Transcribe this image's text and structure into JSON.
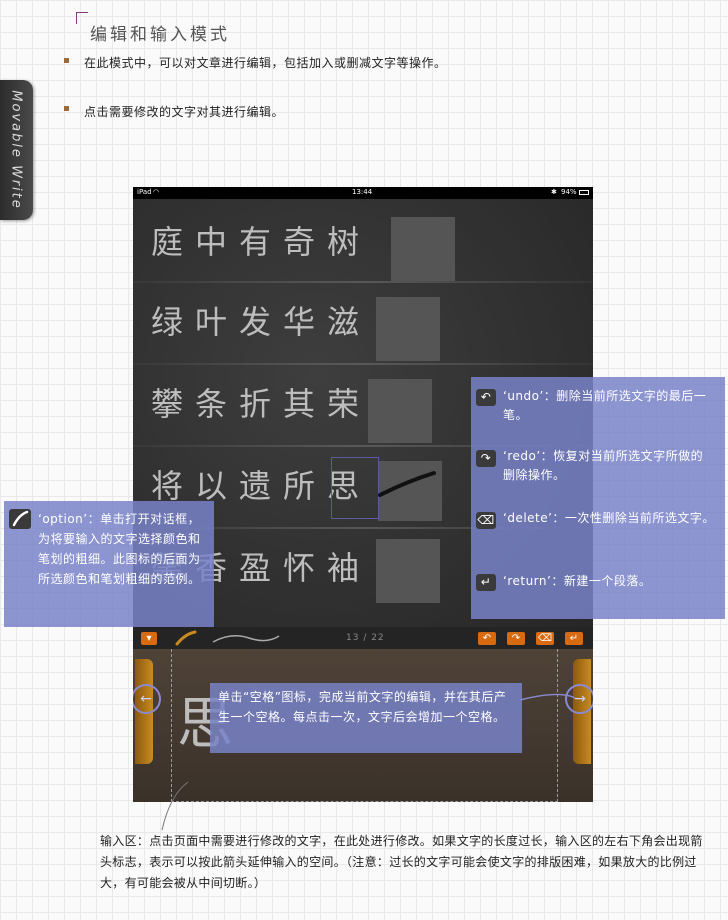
{
  "header": {
    "title": "编辑和输入模式",
    "bullets": [
      "在此模式中，可以对文章进行编辑，包括加入或删减文字等操作。",
      "点击需要修改的文字对其进行编辑。"
    ]
  },
  "side_tab": {
    "label": "Movable Write"
  },
  "ipad": {
    "status": {
      "carrier": "iPad",
      "time": "13:44",
      "battery": "94%"
    },
    "lines": [
      "庭中有奇树",
      "绿叶发华滋",
      "攀条折其荣",
      "将以遗所思",
      "馨香盈怀袖"
    ],
    "page_indicator": "13 / 22",
    "input_char": "思",
    "toolbar_icons": [
      "undo-icon",
      "redo-icon",
      "delete-icon",
      "return-icon"
    ]
  },
  "callouts": {
    "edit_buttons": [
      {
        "icon": "undo-icon",
        "glyph": "↶",
        "text": "‘undo’：删除当前所选文字的最后一笔。"
      },
      {
        "icon": "redo-icon",
        "glyph": "↷",
        "text": "‘redo’：恢复对当前所选文字所做的删除操作。"
      },
      {
        "icon": "delete-icon",
        "glyph": "⌫",
        "text": "‘delete’：一次性删除当前所选文字。"
      },
      {
        "icon": "return-icon",
        "glyph": "↵",
        "text": "‘return’：新建一个段落。"
      }
    ],
    "option": {
      "text": "‘option’：单击打开对话框，为将要输入的文字选择颜色和笔划的粗细。此图标的后面为所选颜色和笔划粗细的范例。"
    },
    "space": {
      "text": "单击“空格”图标，完成当前文字的编辑，并在其后产生一个空格。每点击一次，文字后会增加一个空格。"
    }
  },
  "footer": {
    "text": "输入区：点击页面中需要进行修改的文字，在此处进行修改。如果文字的长度过长，输入区的左右下角会出现箭头标志，表示可以按此箭头延伸输入的空间。（注意：过长的文字可能会使文字的排版困难，如果放大的比例过大，有可能会被从中间切断。）"
  },
  "colors": {
    "panel": "#7882c8",
    "accent": "#d86a10",
    "bullet": "#9a6a3a"
  }
}
